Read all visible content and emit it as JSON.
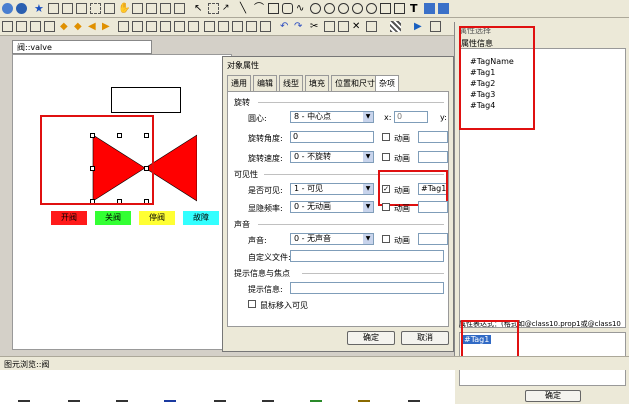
{
  "canvas": {
    "window_title": "阀::valve"
  },
  "legend": [
    {
      "label": "开阀",
      "color": "#ff1a1a"
    },
    {
      "label": "关阀",
      "color": "#33ff33"
    },
    {
      "label": "停阀",
      "color": "#ffff33"
    },
    {
      "label": "故障",
      "color": "#33ffff"
    }
  ],
  "status": {
    "text": "图元浏览::阀"
  },
  "dialog": {
    "title": "对象属性",
    "tabs": [
      "通用",
      "编辑",
      "线型",
      "填充",
      "位置和尺寸",
      "杂项"
    ],
    "active_tab": "杂项",
    "sections": {
      "rotate": "旋转",
      "visible": "可见性",
      "sound": "声音",
      "tip": "提示信息与焦点"
    },
    "rows": {
      "center_label": "圆心:",
      "center_value": "8 - 中心点",
      "x_label": "x:",
      "x_value": "0",
      "y_label": "y:",
      "angle_label": "旋转角度:",
      "angle_value": "0",
      "speed_label": "旋转速度:",
      "speed_value": "0 - 不旋转",
      "visible_label": "是否可见:",
      "visible_value": "1 - 可见",
      "blink_label": "显隐频率:",
      "blink_value": "0 - 无动画",
      "sound_label": "声音:",
      "sound_value": "0 - 无声音",
      "custom_file_label": "自定义文件:",
      "tip_label": "提示信息:",
      "mouse_label": "鼠标移入可见",
      "animate_label": "动画",
      "visible_expr": "#Tag1"
    },
    "ok": "确定",
    "cancel": "取消"
  },
  "side": {
    "title": "属性选择",
    "list_title": "属性信息",
    "items": [
      "#TagName",
      "#Tag1",
      "#Tag2",
      "#Tag3",
      "#Tag4"
    ],
    "expr_label": "属性表达式：(格式如@class10.prop1或@class10",
    "expr_value": "#Tag1",
    "ok": "确定"
  }
}
